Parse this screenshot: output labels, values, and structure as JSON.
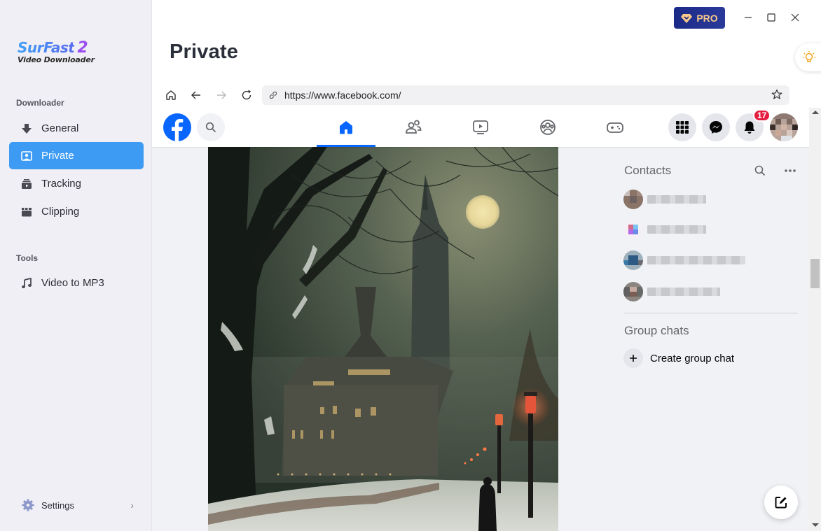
{
  "app": {
    "logo_main": "SurFast",
    "logo_version": "2",
    "logo_sub": "Video Downloader",
    "pro_label": "PRO"
  },
  "sidebar": {
    "sections": [
      {
        "label": "Downloader"
      },
      {
        "label": "Tools"
      }
    ],
    "items": [
      {
        "label": "General",
        "icon": "download-icon",
        "active": false
      },
      {
        "label": "Private",
        "icon": "private-browser-icon",
        "active": true
      },
      {
        "label": "Tracking",
        "icon": "tracking-icon",
        "active": false
      },
      {
        "label": "Clipping",
        "icon": "clipping-icon",
        "active": false
      },
      {
        "label": "Video to MP3",
        "icon": "music-note-icon",
        "active": false
      }
    ],
    "settings_label": "Settings"
  },
  "page": {
    "title": "Private"
  },
  "browser": {
    "url": "https://www.facebook.com/"
  },
  "facebook": {
    "notification_count": "17",
    "tabs": [
      {
        "name": "home",
        "active": true
      },
      {
        "name": "friends",
        "active": false
      },
      {
        "name": "video",
        "active": false
      },
      {
        "name": "groups",
        "active": false
      },
      {
        "name": "gaming",
        "active": false
      }
    ],
    "contacts_title": "Contacts",
    "contacts": [
      {
        "name": "[blurred]"
      },
      {
        "name": "[blurred]"
      },
      {
        "name": "[blurred]"
      },
      {
        "name": "[blurred]"
      }
    ],
    "group_chats_title": "Group chats",
    "create_group_label": "Create group chat",
    "post_image_alt": "Snowy night scene with gothic town hall, full moon and red street lamps"
  },
  "colors": {
    "accent": "#3d9bf4",
    "facebook_blue": "#0866ff",
    "pro_bg": "#1c2a87",
    "pro_text": "#f9c98a",
    "badge_red": "#e41e3f"
  }
}
